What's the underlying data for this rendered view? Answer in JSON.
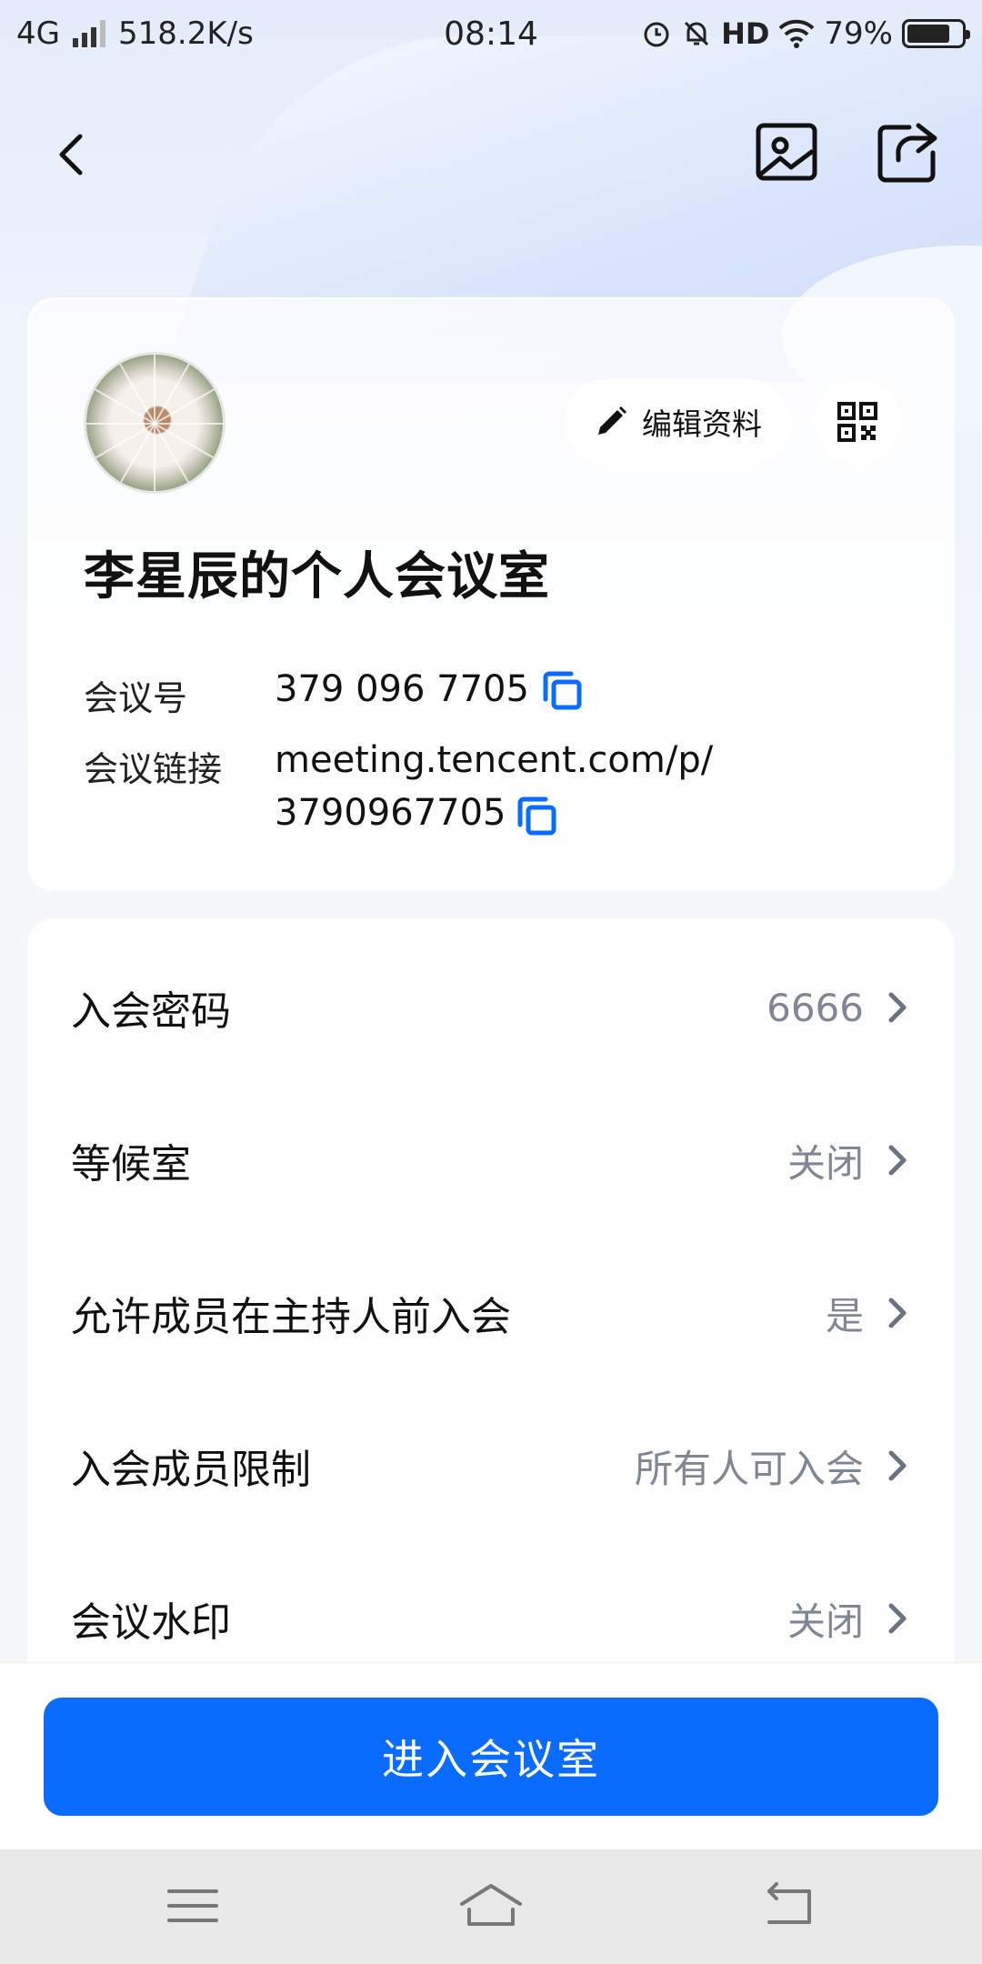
{
  "status_bar": {
    "network": "4G",
    "speed": "518.2K/s",
    "time": "08:14",
    "hd": "HD",
    "battery": "79%",
    "battery_level": 0.79
  },
  "nav": {
    "back_icon": "back-arrow-icon",
    "gallery_icon": "image-icon",
    "share_icon": "share-icon"
  },
  "profile": {
    "edit_label": "编辑资料",
    "room_title": "李星辰的个人会议室",
    "meeting_id_label": "会议号",
    "meeting_id": "379 096 7705",
    "meeting_link_label": "会议链接",
    "meeting_link_line1": "meeting.tencent.com/p/",
    "meeting_link_line2": "3790967705"
  },
  "settings": [
    {
      "label": "入会密码",
      "value": "6666"
    },
    {
      "label": "等候室",
      "value": "关闭"
    },
    {
      "label": "允许成员在主持人前入会",
      "value": "是"
    },
    {
      "label": "入会成员限制",
      "value": "所有人可入会"
    },
    {
      "label": "会议水印",
      "value": "关闭"
    }
  ],
  "enter_button": "进入会议室",
  "colors": {
    "accent": "#0a6cff",
    "muted_text": "#7f8794"
  }
}
